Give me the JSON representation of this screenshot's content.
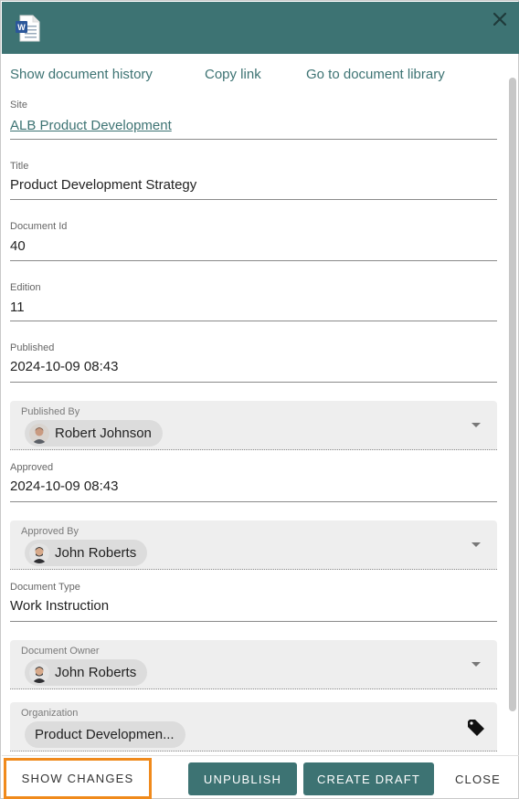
{
  "header": {
    "icon": "word-document-icon",
    "close_icon": "close-icon",
    "color": "#3d7373"
  },
  "links": {
    "history": "Show document history",
    "copy": "Copy link",
    "library": "Go to document library"
  },
  "fields": {
    "site": {
      "label": "Site",
      "value": "ALB Product Development"
    },
    "title": {
      "label": "Title",
      "value": "Product Development Strategy"
    },
    "document_id": {
      "label": "Document Id",
      "value": "40"
    },
    "edition": {
      "label": "Edition",
      "value": "11"
    },
    "published": {
      "label": "Published",
      "value": "2024-10-09 08:43"
    },
    "published_by": {
      "label": "Published By",
      "value": "Robert Johnson"
    },
    "approved": {
      "label": "Approved",
      "value": "2024-10-09 08:43"
    },
    "approved_by": {
      "label": "Approved By",
      "value": "John Roberts"
    },
    "document_type": {
      "label": "Document Type",
      "value": "Work Instruction"
    },
    "document_owner": {
      "label": "Document Owner",
      "value": "John Roberts"
    },
    "organization": {
      "label": "Organization",
      "value": "Product Developmen..."
    }
  },
  "footer": {
    "show_changes": "SHOW CHANGES",
    "unpublish": "UNPUBLISH",
    "create_draft": "CREATE DRAFT",
    "close": "CLOSE",
    "highlight_color": "#f08a1c"
  }
}
